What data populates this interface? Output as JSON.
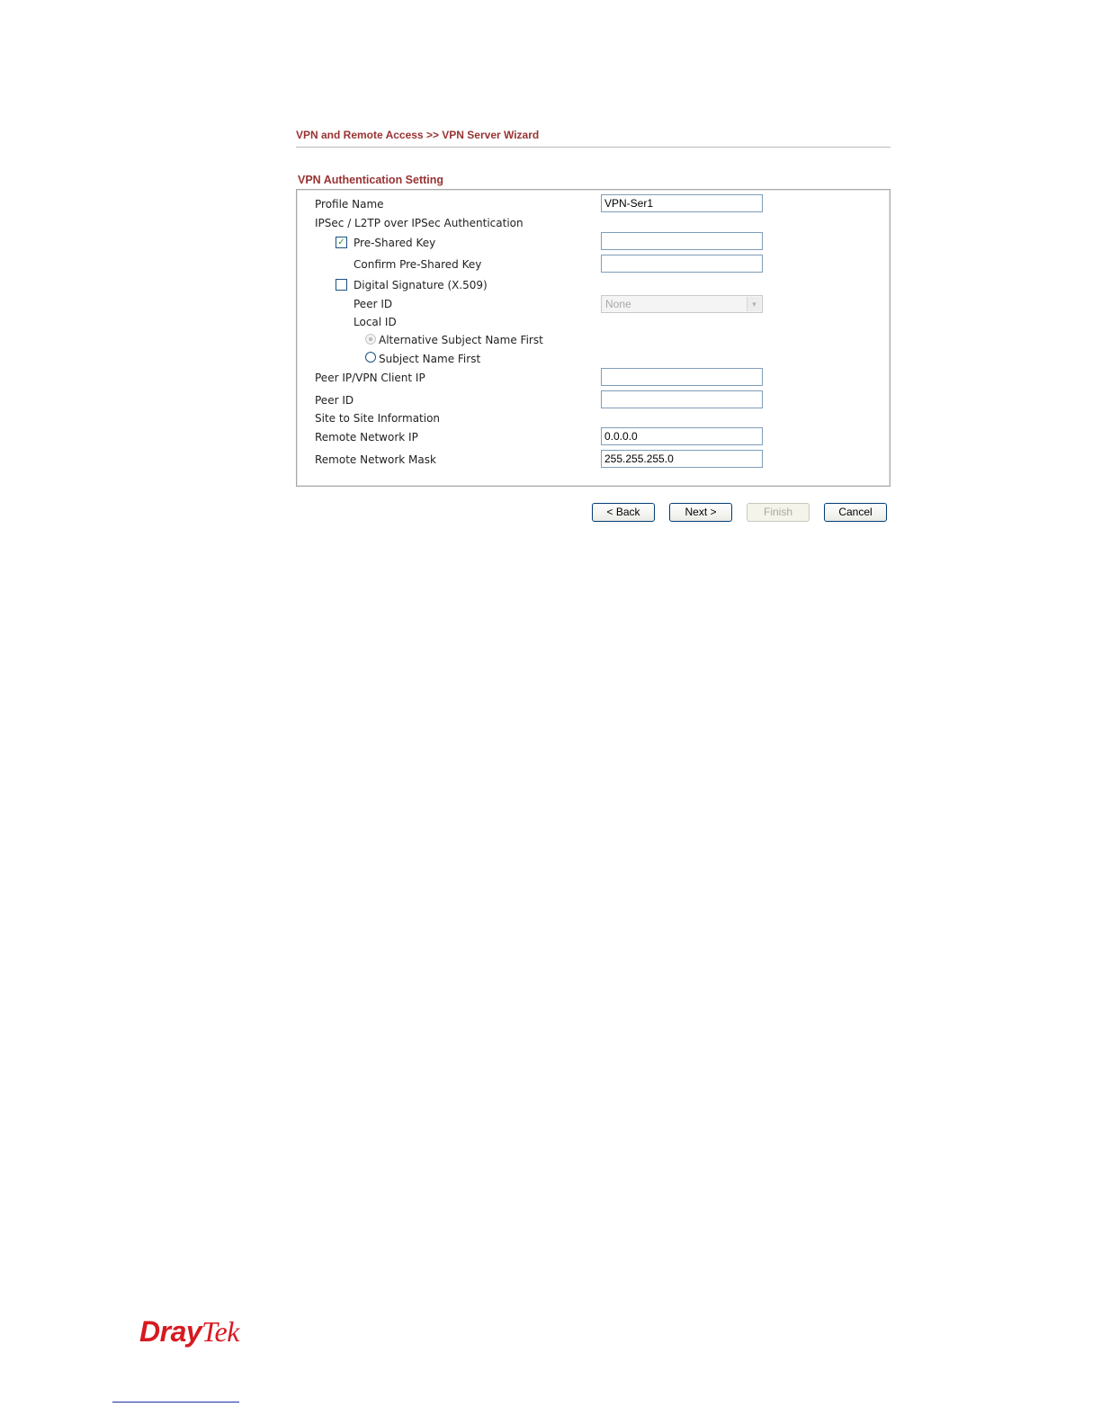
{
  "breadcrumb": "VPN and Remote Access >> VPN Server Wizard",
  "section_title": "VPN Authentication Setting",
  "form": {
    "profile_name": {
      "label": "Profile Name",
      "value": "VPN-Ser1"
    },
    "ipsec_auth_label": "IPSec / L2TP over IPSec Authentication",
    "pre_shared_key": {
      "label": "Pre-Shared Key",
      "checked": true,
      "value": ""
    },
    "confirm_pre_shared_key": {
      "label": "Confirm Pre-Shared Key",
      "value": ""
    },
    "digital_signature": {
      "label": "Digital Signature (X.509)",
      "checked": false
    },
    "peer_id_select": {
      "label": "Peer ID",
      "selected": "None"
    },
    "local_id_label": "Local ID",
    "local_id_options": [
      {
        "label": "Alternative Subject Name First",
        "selected": true,
        "disabled": true
      },
      {
        "label": "Subject Name First",
        "selected": false,
        "disabled": false
      }
    ],
    "peer_ip": {
      "label": "Peer IP/VPN Client IP",
      "value": ""
    },
    "peer_id": {
      "label": "Peer ID",
      "value": ""
    },
    "site_to_site_label": "Site to Site Information",
    "remote_network_ip": {
      "label": "Remote Network IP",
      "value": "0.0.0.0"
    },
    "remote_network_mask": {
      "label": "Remote Network Mask",
      "value": "255.255.255.0"
    }
  },
  "buttons": {
    "back": "< Back",
    "next": "Next >",
    "finish": "Finish",
    "cancel": "Cancel"
  },
  "footer": {
    "logo_dray": "Dray",
    "logo_tek": "Tek"
  },
  "colors": {
    "heading": "#993333",
    "check_mark": "#21a121",
    "logo": "#d71920"
  },
  "icons": {
    "check": "✓",
    "dropdown": "▾"
  }
}
